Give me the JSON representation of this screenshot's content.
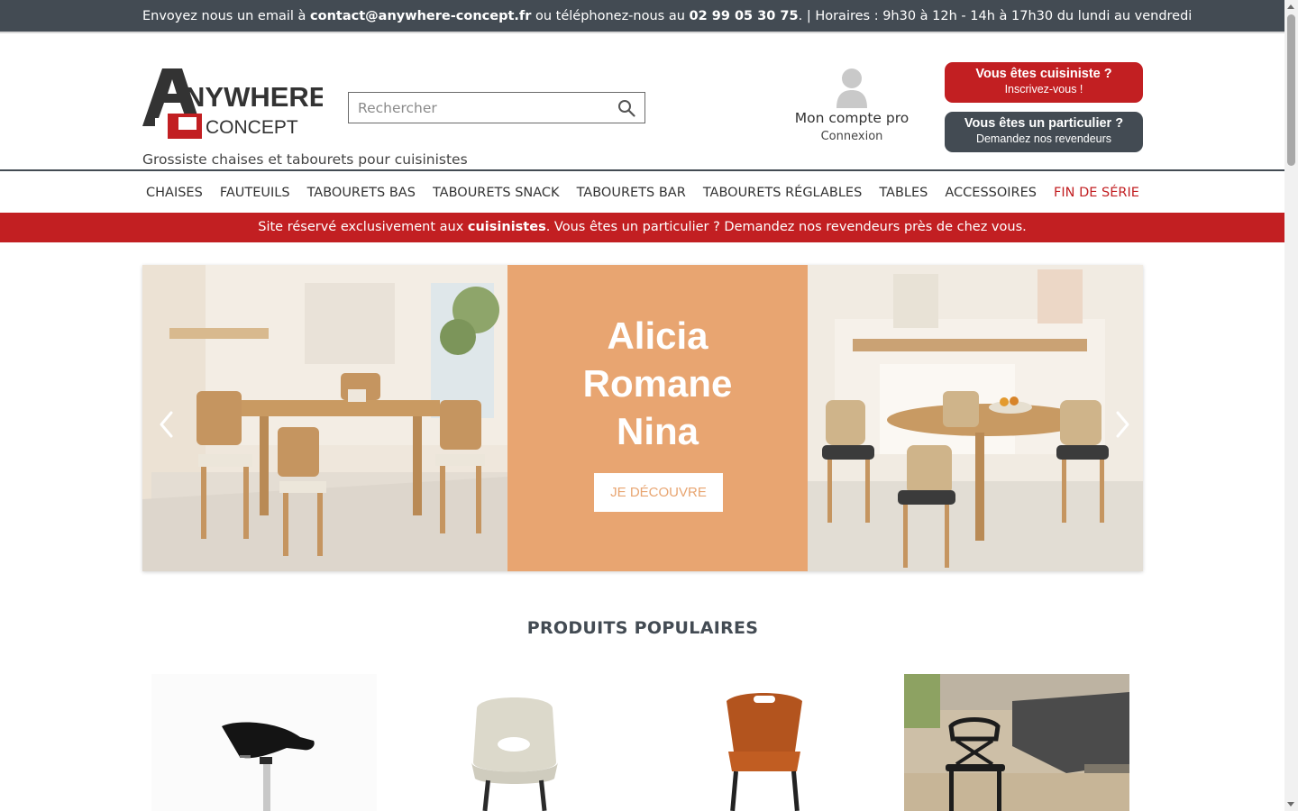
{
  "topbar": {
    "email_prefix": "Envoyez nous un email à ",
    "email": "contact@anywhere-concept.fr",
    "phone_prefix": " ou téléphonez-nous au ",
    "phone": "02 99 05 30 75",
    "hours": ". | Horaires : 9h30 à 12h - 14h à 17h30 du lundi au vendredi"
  },
  "header": {
    "logo_line1": "NYWHERE",
    "logo_line2": "CONCEPT",
    "logo_letter": "A",
    "tagline": "Grossiste chaises et tabourets pour cuisinistes",
    "search_placeholder": "Rechercher",
    "account_title": "Mon compte pro",
    "account_sub": "Connexion",
    "cta_pro_title": "Vous êtes cuisiniste ?",
    "cta_pro_sub": "Inscrivez-vous !",
    "cta_private_title": "Vous êtes un particulier ?",
    "cta_private_sub": "Demandez nos revendeurs"
  },
  "nav": {
    "items": [
      "Chaises",
      "Fauteuils",
      "Tabourets bas",
      "Tabourets snack",
      "Tabourets bar",
      "Tabourets réglables",
      "Tables",
      "Accessoires",
      "Fin de série"
    ]
  },
  "notice": {
    "before": "Site réservé exclusivement aux ",
    "bold": "cuisinistes",
    "after": ". Vous êtes un particulier ? Demandez nos revendeurs près de chez vous."
  },
  "slider": {
    "names": [
      "Alicia",
      "Romane",
      "Nina"
    ],
    "button": "Je découvre"
  },
  "popular": {
    "title": "PRODUITS POPULAIRES"
  },
  "colors": {
    "dark": "#434b53",
    "red": "#c21f22",
    "peach": "#e8a571"
  }
}
